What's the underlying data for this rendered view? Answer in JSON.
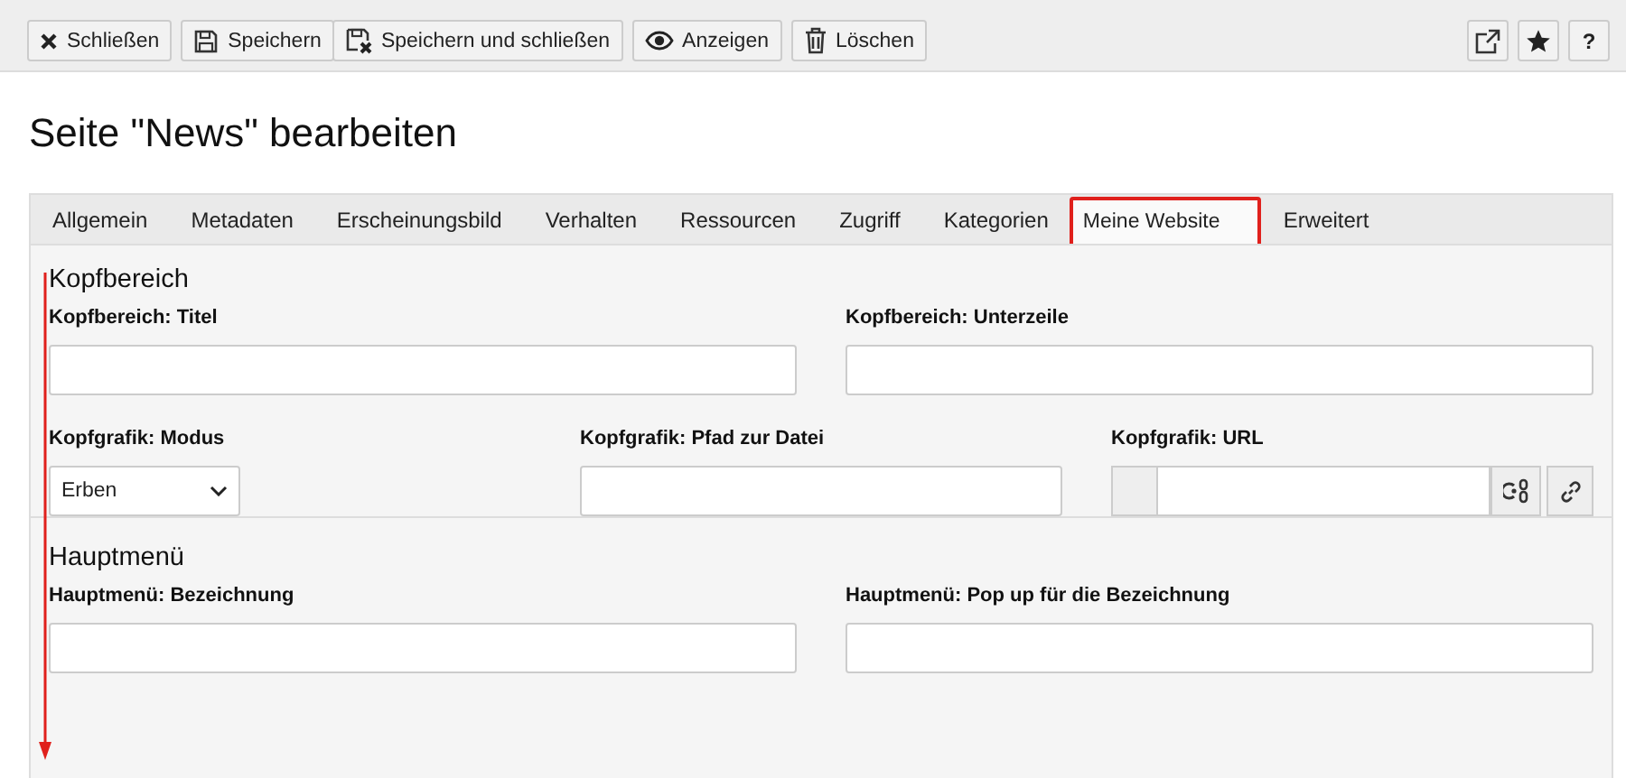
{
  "toolbar": {
    "left_groups": [
      {
        "buttons": [
          {
            "kind": "close",
            "label": "Schließen"
          }
        ]
      },
      {
        "buttons": [
          {
            "kind": "save",
            "label": "Speichern"
          },
          {
            "kind": "save-close",
            "label": "Speichern und schließen"
          }
        ]
      },
      {
        "buttons": [
          {
            "kind": "view",
            "label": "Anzeigen"
          }
        ]
      },
      {
        "buttons": [
          {
            "kind": "delete",
            "label": "Löschen"
          }
        ]
      }
    ],
    "right_buttons": [
      {
        "kind": "open-new"
      },
      {
        "kind": "star"
      },
      {
        "kind": "text",
        "label": "?"
      }
    ]
  },
  "title": "Seite \"News\" bearbeiten",
  "tabs": [
    {
      "label": "Allgemein",
      "selected": false,
      "highlighted": false
    },
    {
      "label": "Metadaten",
      "selected": false,
      "highlighted": false
    },
    {
      "label": "Erscheinungsbild",
      "selected": false,
      "highlighted": false
    },
    {
      "label": "Verhalten",
      "selected": false,
      "highlighted": false
    },
    {
      "label": "Ressourcen",
      "selected": false,
      "highlighted": false
    },
    {
      "label": "Zugriff",
      "selected": false,
      "highlighted": false
    },
    {
      "label": "Kategorien",
      "selected": false,
      "highlighted": false
    },
    {
      "label": "Meine Website",
      "selected": true,
      "highlighted": true
    },
    {
      "label": "Erweitert",
      "selected": false,
      "highlighted": false
    }
  ],
  "sections": [
    {
      "title": "Kopfbereich",
      "rows": [
        {
          "fields": [
            {
              "kind": "text",
              "label": "Kopfbereich: Titel"
            },
            {
              "kind": "text",
              "label": "Kopfbereich: Unterzeile"
            }
          ]
        },
        {
          "fields": [
            {
              "kind": "select",
              "label": "Kopfgrafik: Modus",
              "value": "Erben"
            },
            {
              "kind": "text",
              "label": "Kopfgrafik: Pfad zur Datei"
            },
            {
              "kind": "url",
              "label": "Kopfgrafik: URL"
            }
          ]
        }
      ]
    },
    {
      "title": "Hauptmenü",
      "rows": [
        {
          "fields": [
            {
              "kind": "text",
              "label": "Hauptmenü: Bezeichnung"
            },
            {
              "kind": "text",
              "label": "Hauptmenü: Pop up für die Bezeichnung"
            }
          ]
        }
      ]
    }
  ]
}
